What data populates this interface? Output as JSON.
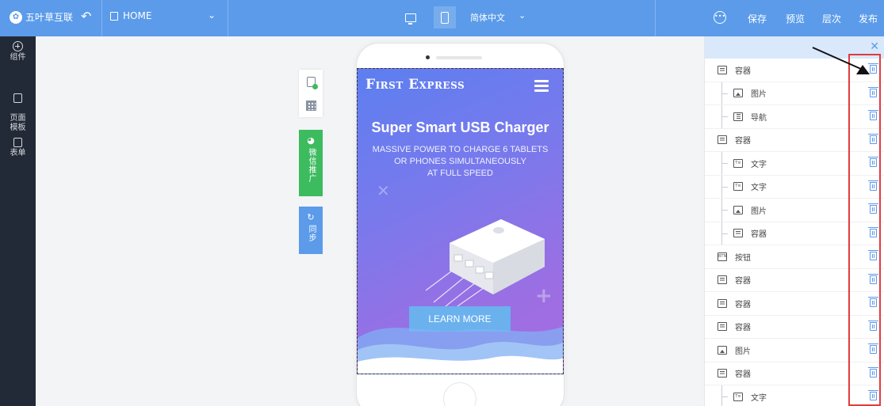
{
  "topbar": {
    "logo_text": "五叶草互联",
    "page_name": "HOME",
    "language": "简体中文",
    "actions": [
      "保存",
      "预览",
      "层次",
      "发布"
    ]
  },
  "leftnav": {
    "items": [
      {
        "label": "组件"
      },
      {
        "label": "页面\n模板"
      },
      {
        "label": "表单"
      }
    ]
  },
  "tools": {
    "wechat_label": "微信推广",
    "sync_label": "同步"
  },
  "preview": {
    "brand": "First Express",
    "headline": "Super Smart USB Charger",
    "subline": "MASSIVE POWER TO CHARGE 6 TABLETS\nOR PHONES SIMULTANEOUSLY\nAT FULL SPEED",
    "cta": "LEARN MORE"
  },
  "layers": [
    {
      "label": "容器",
      "type": "box",
      "indent": 0
    },
    {
      "label": "图片",
      "type": "img",
      "indent": 1
    },
    {
      "label": "导航",
      "type": "nav",
      "indent": 1
    },
    {
      "label": "容器",
      "type": "box",
      "indent": 0
    },
    {
      "label": "文字",
      "type": "text",
      "indent": 1
    },
    {
      "label": "文字",
      "type": "text",
      "indent": 1
    },
    {
      "label": "图片",
      "type": "img",
      "indent": 1
    },
    {
      "label": "容器",
      "type": "box",
      "indent": 1
    },
    {
      "label": "按钮",
      "type": "btn",
      "indent": 0
    },
    {
      "label": "容器",
      "type": "box",
      "indent": 0
    },
    {
      "label": "容器",
      "type": "box",
      "indent": 0
    },
    {
      "label": "容器",
      "type": "box",
      "indent": 0
    },
    {
      "label": "图片",
      "type": "img",
      "indent": 0
    },
    {
      "label": "容器",
      "type": "box",
      "indent": 0
    },
    {
      "label": "文字",
      "type": "text",
      "indent": 1
    }
  ],
  "colors": {
    "accent": "#5b9bea",
    "nav_bg": "#232a37",
    "wechat_green": "#3cbb5f",
    "highlight_red": "#e03b3b"
  }
}
